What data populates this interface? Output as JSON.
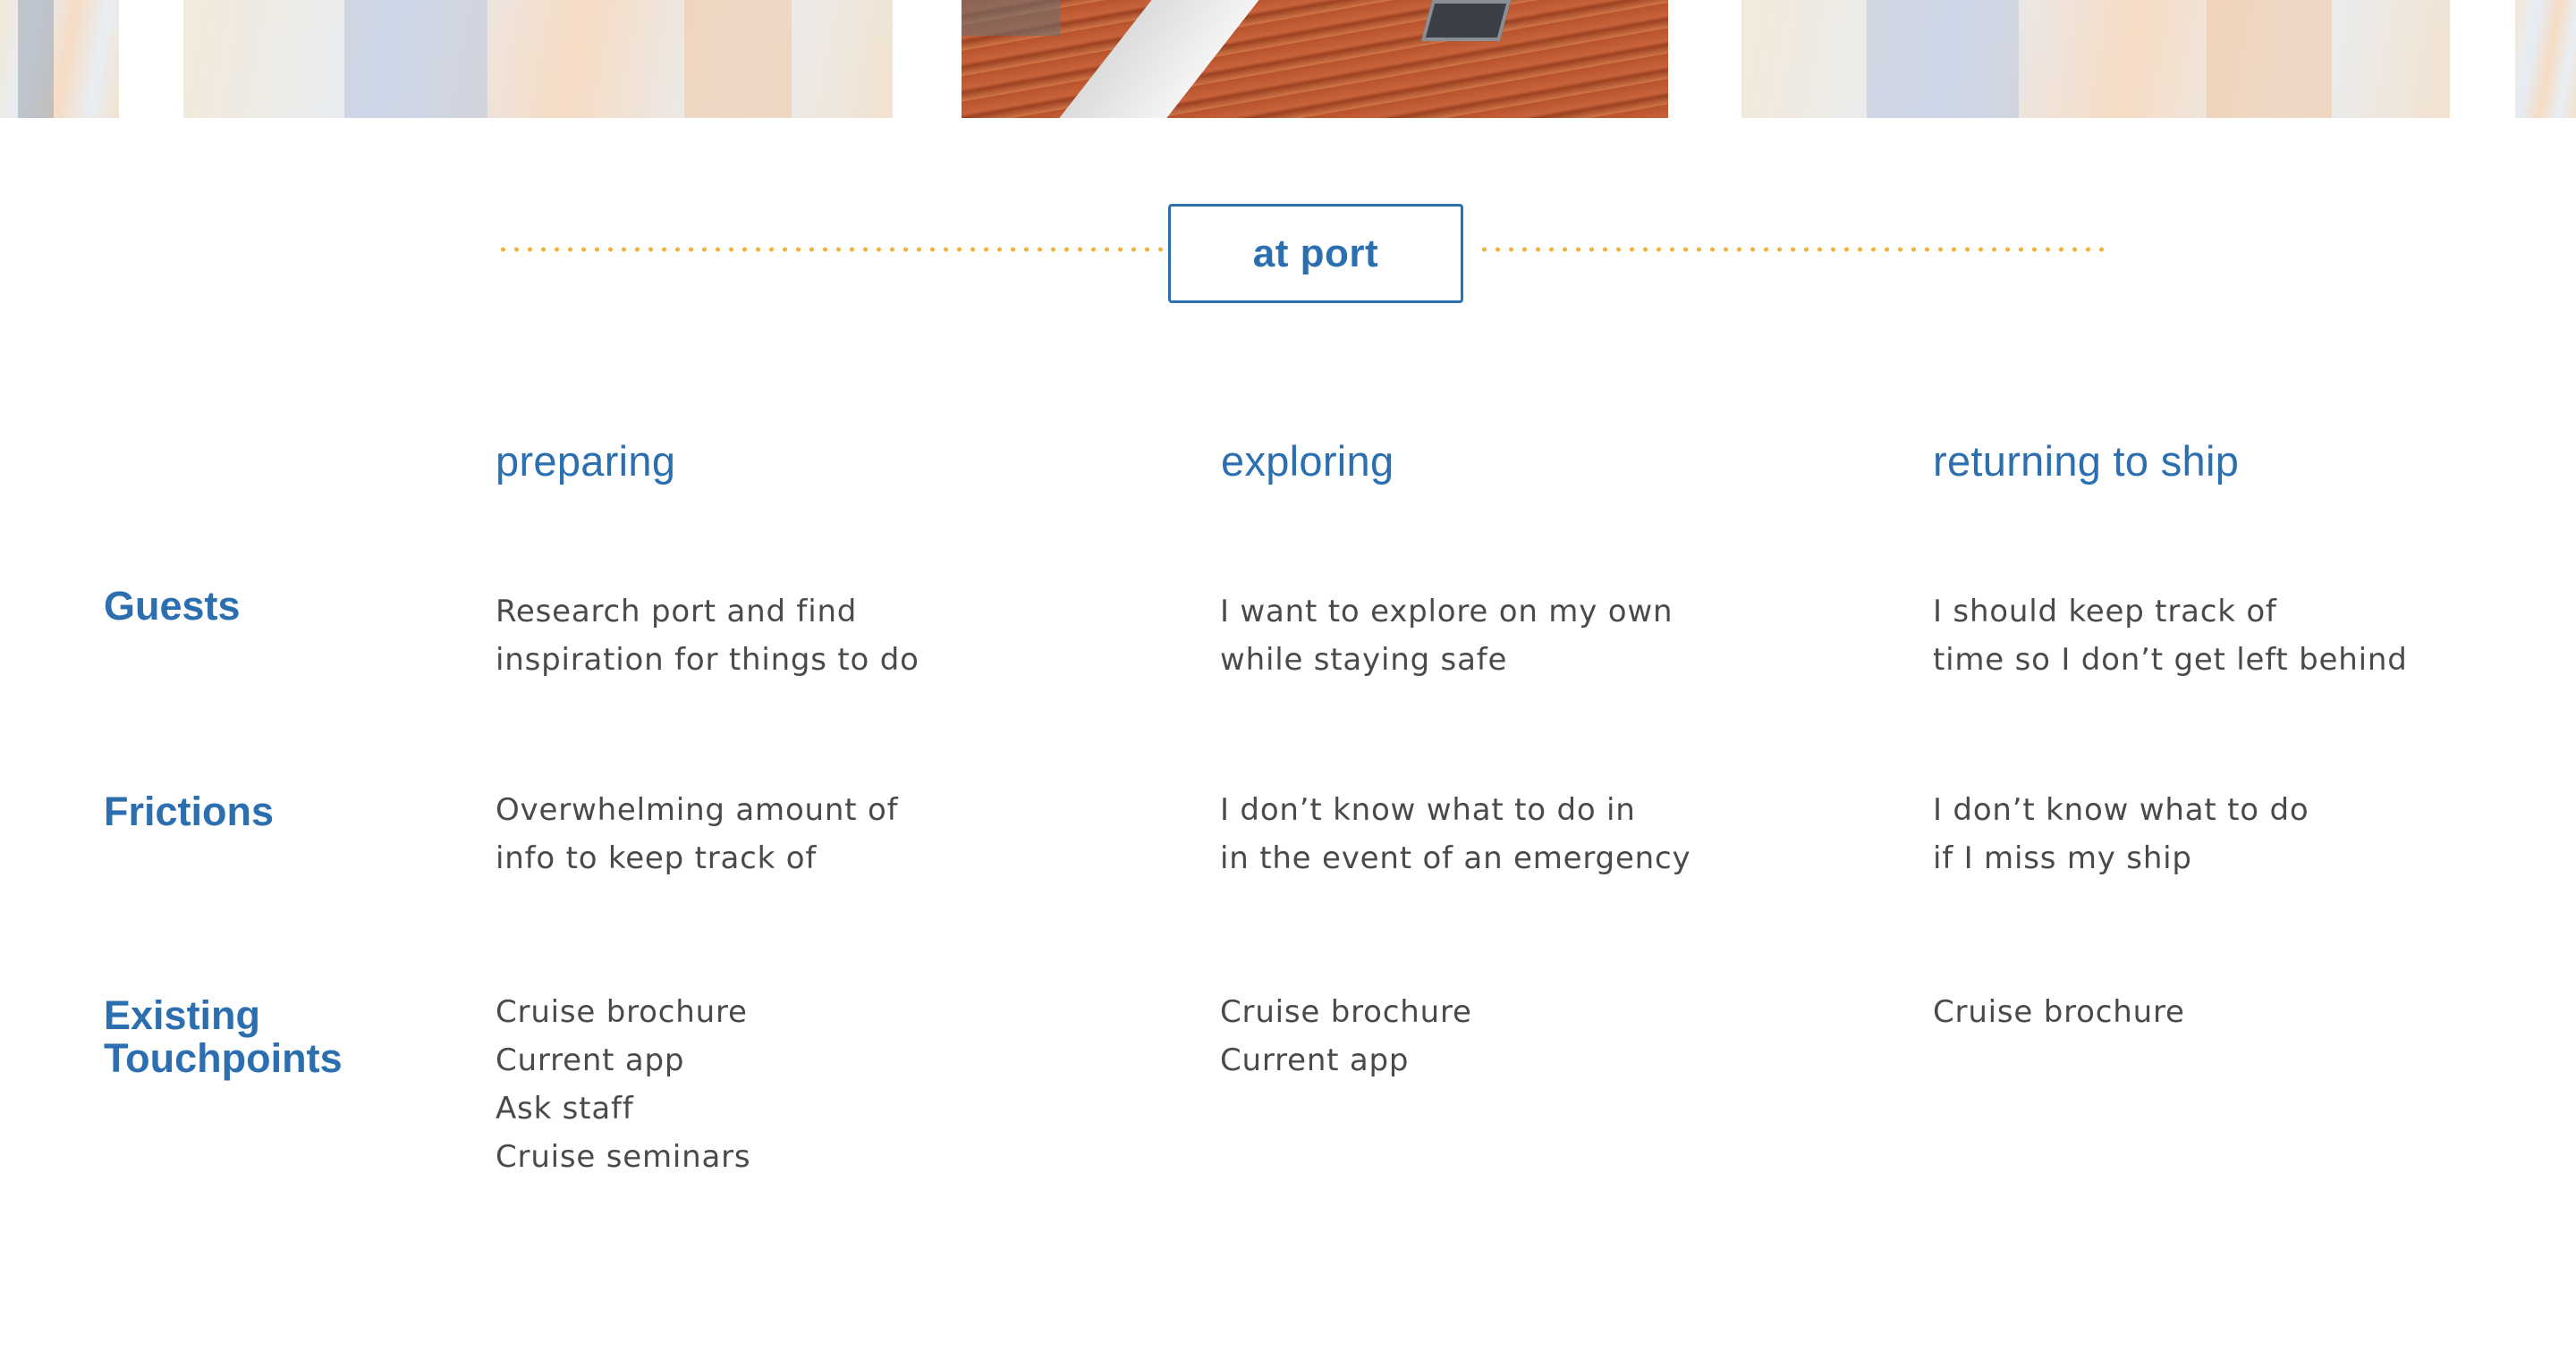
{
  "section": {
    "title": "at port"
  },
  "phases": [
    {
      "label": "preparing"
    },
    {
      "label": "exploring"
    },
    {
      "label": "returning to ship"
    }
  ],
  "rows": [
    {
      "label_lines": [
        "Guests"
      ],
      "cells": [
        [
          "Research port and find",
          "inspiration for things to do"
        ],
        [
          "I want to explore on my own",
          "while staying safe"
        ],
        [
          "I should keep track of",
          "time so I don’t get left behind"
        ]
      ]
    },
    {
      "label_lines": [
        "Frictions"
      ],
      "cells": [
        [
          "Overwhelming amount of",
          "info to keep track of"
        ],
        [
          "I don’t know what to do in",
          "in the event of an emergency"
        ],
        [
          "I don’t know what to do",
          "if I miss my ship"
        ]
      ]
    },
    {
      "label_lines": [
        "Existing",
        "Touchpoints"
      ],
      "cells": [
        [
          "Cruise brochure",
          "Current app",
          "Ask staff",
          "Cruise seminars"
        ],
        [
          "Cruise brochure",
          "Current app"
        ],
        [
          "Cruise brochure"
        ]
      ]
    }
  ],
  "colors": {
    "accent_blue": "#2c6fb0",
    "dot_yellow": "#f2b233",
    "body_text": "#4a4a4a"
  }
}
